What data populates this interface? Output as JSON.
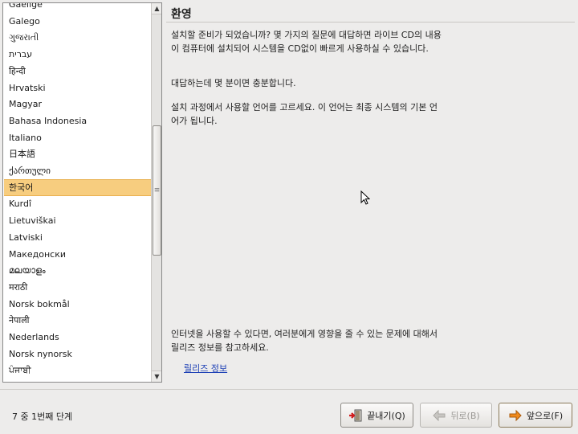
{
  "languages": [
    "Gaeilge",
    "Galego",
    "ગુજરાતી",
    "עברית",
    "हिन्दी",
    "Hrvatski",
    "Magyar",
    "Bahasa Indonesia",
    "Italiano",
    "日本語",
    "ქართული",
    "한국어",
    "Kurdî",
    "Lietuviškai",
    "Latviski",
    "Македонски",
    "മലയാളം",
    "मराठी",
    "Norsk bokmål",
    "नेपाली",
    "Nederlands",
    "Norsk nynorsk",
    "ਪੰਜਾਬੀ"
  ],
  "selected_language": "한국어",
  "panel": {
    "title": "환영",
    "para1": "설치할 준비가 되었습니까? 몇 가지의 질문에 대답하면 라이브 CD의 내용이 컴퓨터에 설치되어 시스템을 CD없이 빠르게 사용하실 수 있습니다.",
    "para2": "대답하는데 몇 분이면 충분합니다.",
    "para3": "설치 과정에서 사용할 언어를 고르세요. 이 언어는 최종 시스템의 기본 언어가 됩니다.",
    "para4": "인터넷을 사용할 수 있다면, 여러분에게 영향을 줄 수 있는 문제에 대해서 릴리즈 정보를 참고하세요.",
    "release_notes_link": "릴리즈 정보"
  },
  "footer": {
    "step_label": "7 중 1번째 단계",
    "exit_label": "끝내기(Q)",
    "back_label": "뒤로(B)",
    "forward_label": "앞으로(F)"
  },
  "colors": {
    "selection": "#f7cd7f",
    "link": "#1c3fb5",
    "background": "#edeceb"
  },
  "icons": {
    "exit": "exit-door-icon",
    "back": "back-arrow-icon",
    "forward": "forward-arrow-icon"
  }
}
